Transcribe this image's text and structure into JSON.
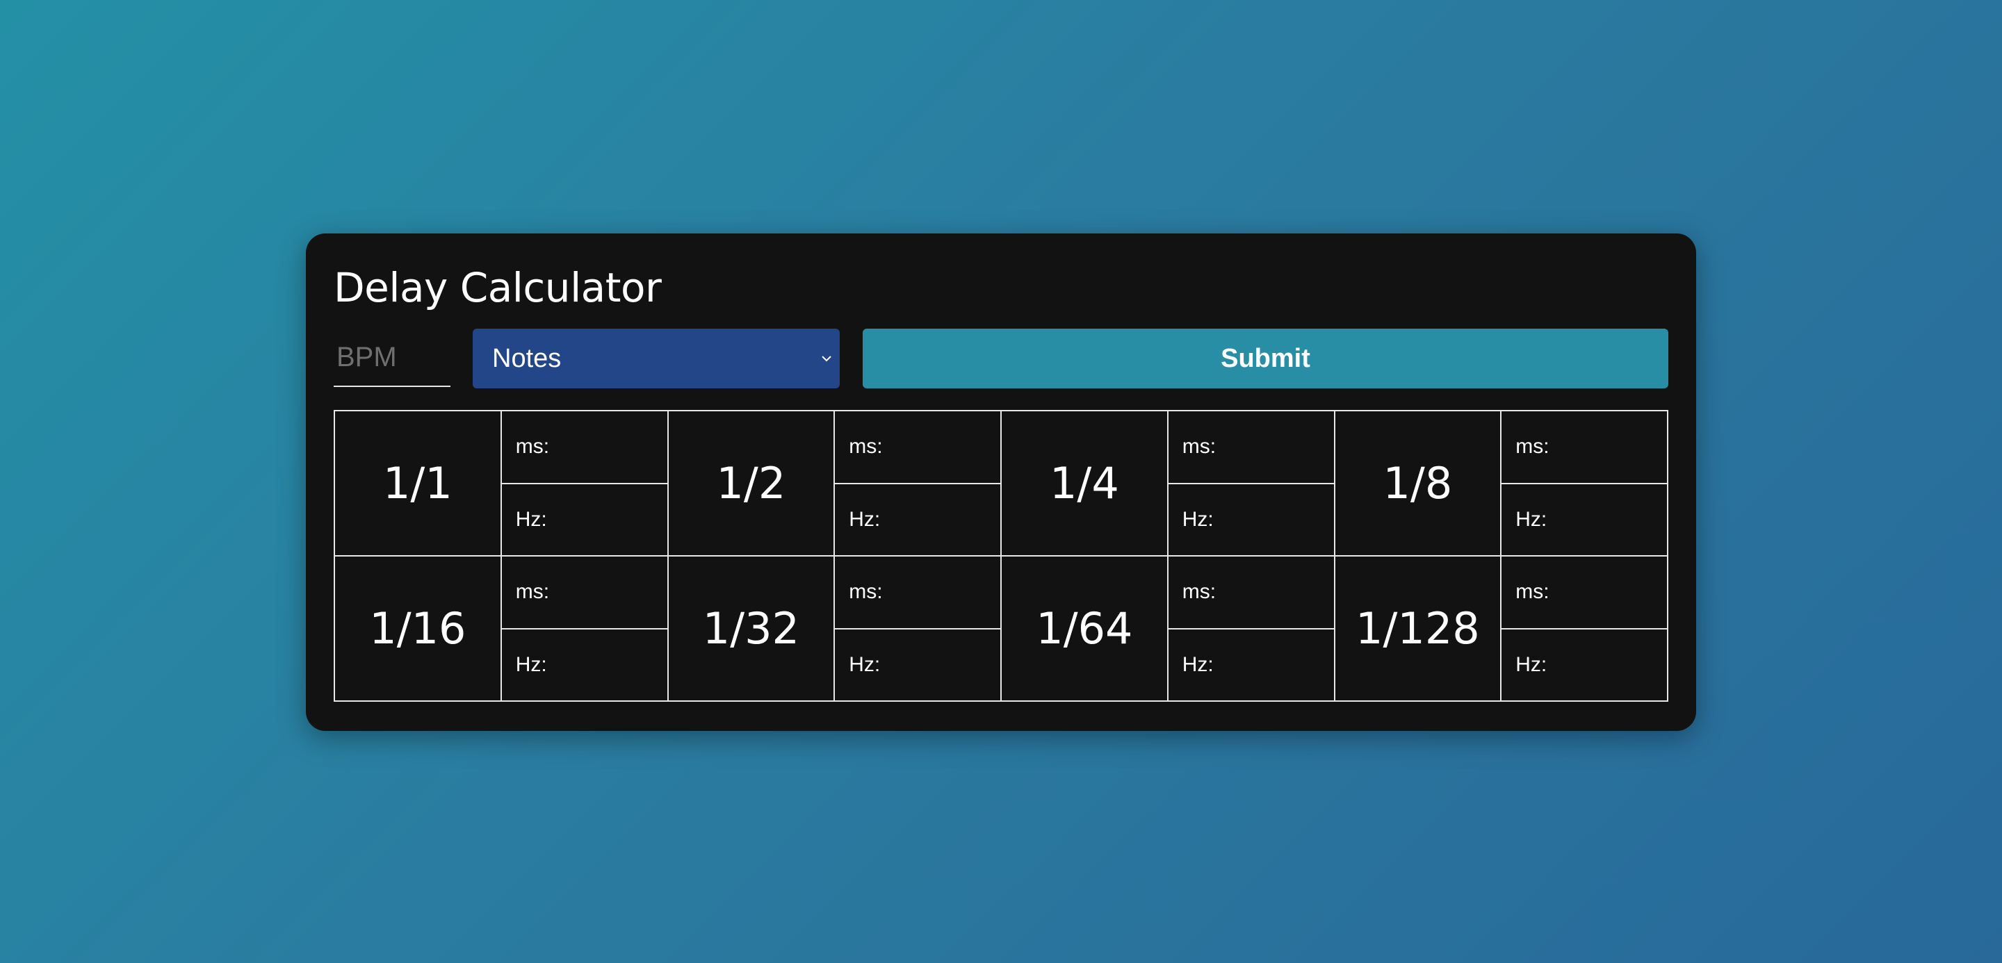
{
  "app": {
    "title": "Delay Calculator"
  },
  "controls": {
    "bpm_placeholder": "BPM",
    "bpm_value": "",
    "select_value": "Notes",
    "submit_label": "Submit"
  },
  "labels": {
    "ms": "ms:",
    "hz": "Hz:"
  },
  "notes": [
    {
      "label": "1/1",
      "ms": "",
      "hz": ""
    },
    {
      "label": "1/2",
      "ms": "",
      "hz": ""
    },
    {
      "label": "1/4",
      "ms": "",
      "hz": ""
    },
    {
      "label": "1/8",
      "ms": "",
      "hz": ""
    },
    {
      "label": "1/16",
      "ms": "",
      "hz": ""
    },
    {
      "label": "1/32",
      "ms": "",
      "hz": ""
    },
    {
      "label": "1/64",
      "ms": "",
      "hz": ""
    },
    {
      "label": "1/128",
      "ms": "",
      "hz": ""
    }
  ],
  "icons": {
    "select_arrow": "chevron-down-icon"
  },
  "colors": {
    "card": "#121212",
    "select": "#234689",
    "submit": "#278ea6",
    "text": "#ffffff"
  }
}
